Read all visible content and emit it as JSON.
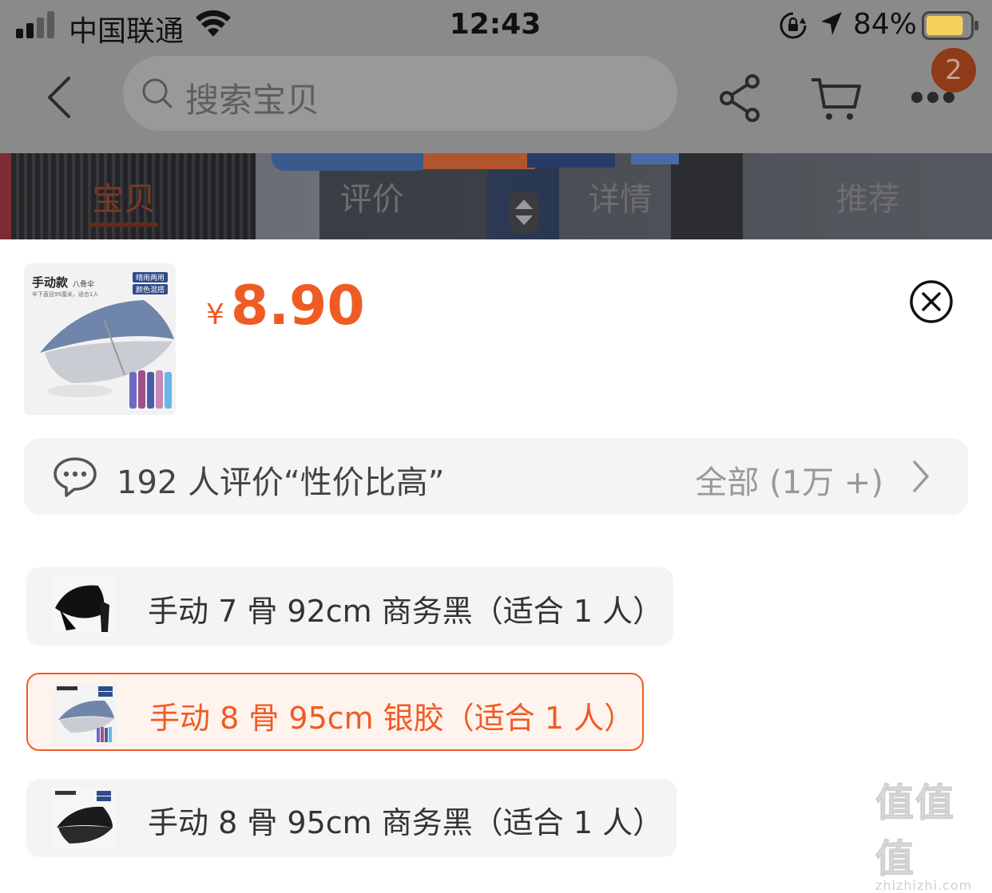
{
  "status_bar": {
    "carrier": "中国联通",
    "time": "12:43",
    "battery_percent": "84%",
    "battery_level": 0.84,
    "battery_color": "#f5d25a"
  },
  "nav": {
    "search_placeholder": "搜索宝贝",
    "cart_badge": "2",
    "icons": [
      "back-icon",
      "search-icon",
      "share-icon",
      "cart-icon",
      "more-icon"
    ]
  },
  "tabs": [
    {
      "label": "宝贝",
      "active": true
    },
    {
      "label": "评价",
      "active": false
    },
    {
      "label": "详情",
      "active": false
    },
    {
      "label": "推荐",
      "active": false
    }
  ],
  "sheet": {
    "currency": "¥",
    "price": "8.90",
    "thumb": {
      "title": "手动款",
      "subtitle": "八骨伞",
      "tag1": "晴雨两用",
      "tag2": "颜色混搭",
      "caption": "伞下直径95厘米，适合1人"
    },
    "review": {
      "text": "192 人评价“性价比高”",
      "all_label": "全部 (1万 +)"
    },
    "options": [
      {
        "label": "手动 7 骨 92cm 商务黑（适合 1 人）",
        "selected": false,
        "thumb": "black-umbrella"
      },
      {
        "label": "手动 8 骨 95cm 银胶（适合 1 人）",
        "selected": true,
        "thumb": "silver-umbrella"
      },
      {
        "label": "手动 8 骨 95cm 商务黑（适合 1 人）",
        "selected": false,
        "thumb": "dark-umbrella"
      }
    ],
    "accent_color": "#ef5b24"
  },
  "watermark": {
    "chars": "值值值",
    "url": "zhizhizhi.com"
  }
}
